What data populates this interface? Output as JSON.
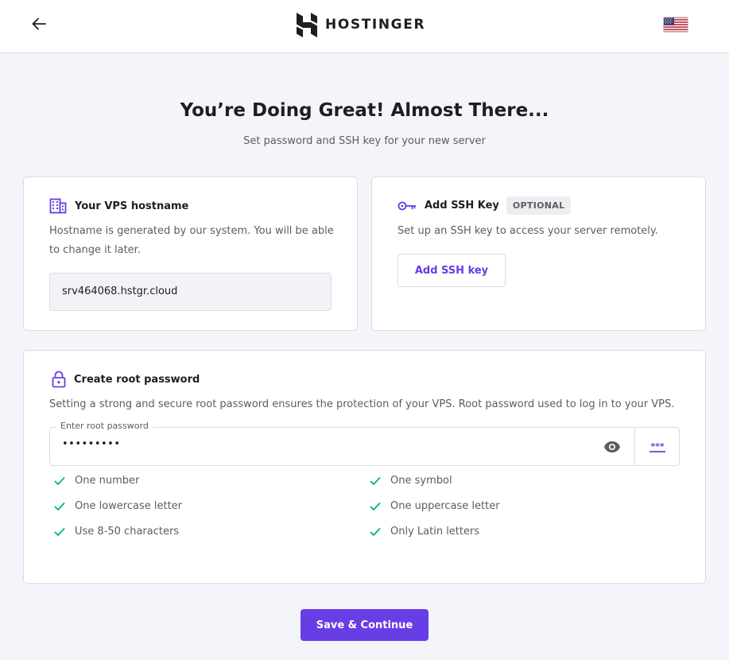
{
  "header": {
    "logo_text": "HOSTINGER",
    "icons": {
      "back": "arrow-left-icon",
      "logo": "hostinger-logo-icon",
      "flag": "us-flag-icon"
    }
  },
  "main": {
    "title": "You’re Doing Great! Almost There...",
    "subtitle": "Set password and SSH key for your new server"
  },
  "hostname_card": {
    "title": "Your VPS hostname",
    "description": "Hostname is generated by our system. You will be able to change it later.",
    "value": "srv464068.hstgr.cloud",
    "icon": "building-icon"
  },
  "ssh_card": {
    "title": "Add SSH Key",
    "badge": "OPTIONAL",
    "description": "Set up an SSH key to access your server remotely.",
    "button_label": "Add SSH key",
    "icon": "key-icon"
  },
  "password_card": {
    "title": "Create root password",
    "description": "Setting a strong and secure root password ensures the protection of your VPS. Root password used to log in to your VPS.",
    "field_label": "Enter root password",
    "field_value": "•••••••••",
    "icon": "lock-icon",
    "requirements": [
      {
        "label": "One number",
        "met": true
      },
      {
        "label": "One symbol",
        "met": true
      },
      {
        "label": "One lowercase letter",
        "met": true
      },
      {
        "label": "One uppercase letter",
        "met": true
      },
      {
        "label": "Use 8-50 characters",
        "met": true
      },
      {
        "label": "Only Latin letters",
        "met": true
      }
    ]
  },
  "footer": {
    "save_label": "Save & Continue"
  },
  "colors": {
    "accent": "#673de6",
    "success": "#00b090",
    "background": "#f4f4fb",
    "text_primary": "#1d1e20",
    "text_secondary": "#5c5d61"
  }
}
